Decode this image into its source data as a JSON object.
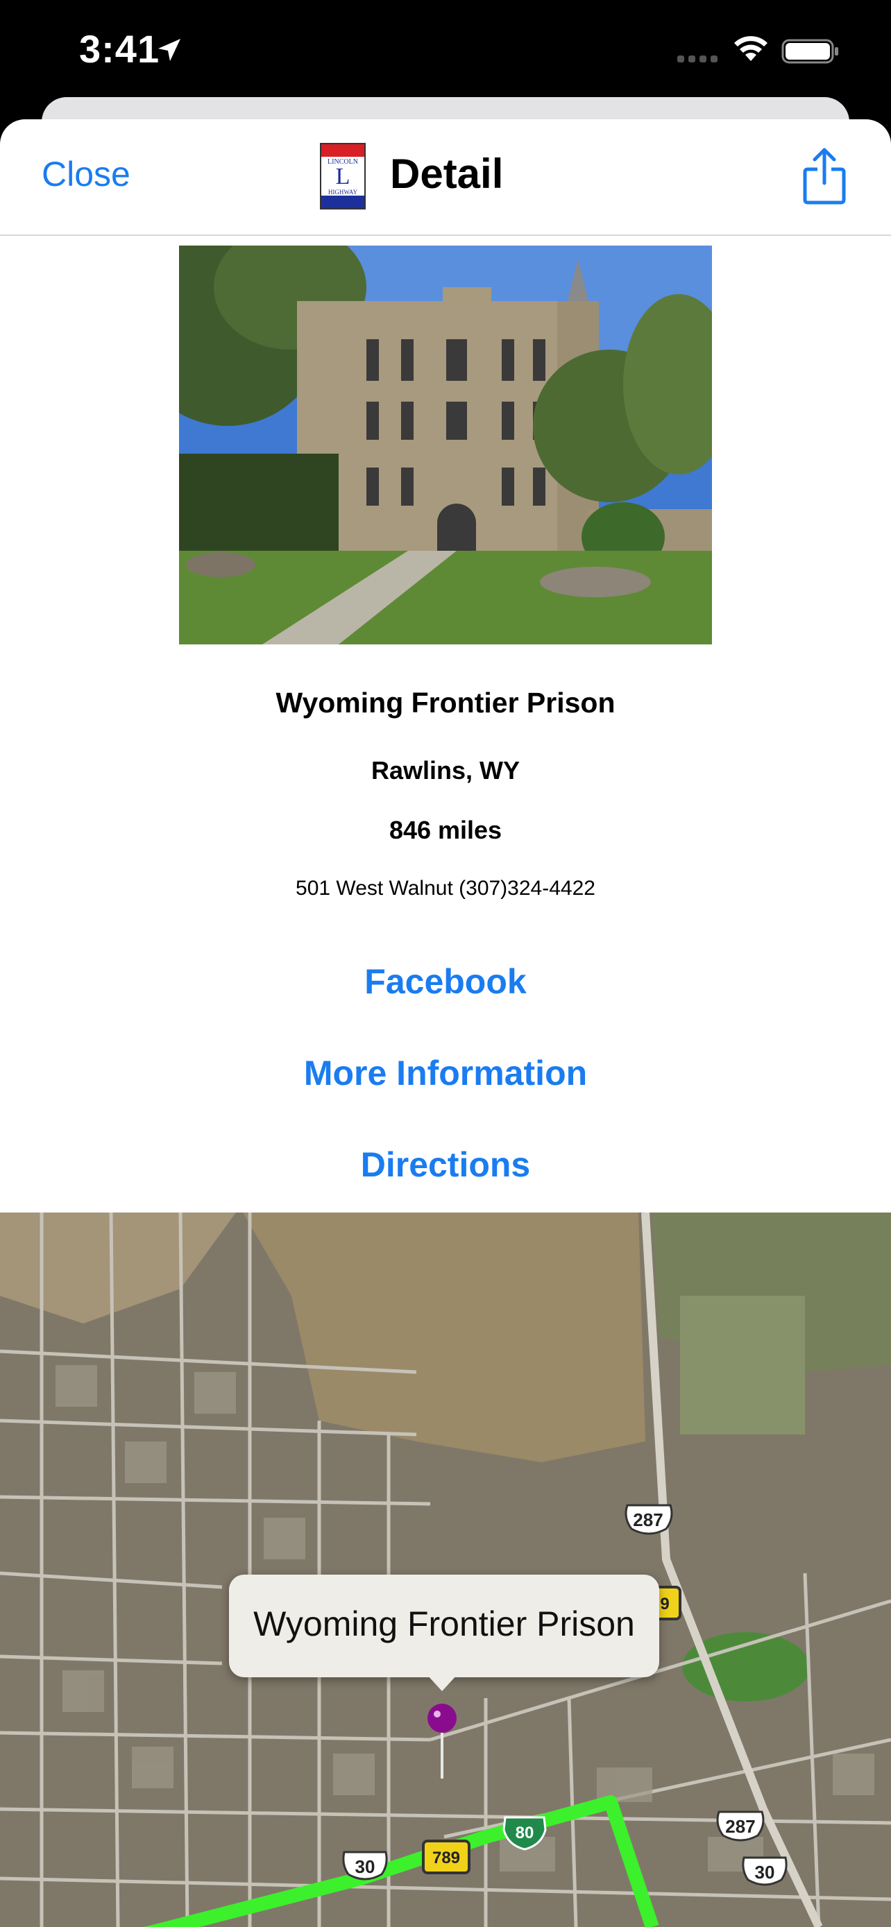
{
  "status_bar": {
    "time": "3:41"
  },
  "nav": {
    "close_label": "Close",
    "title": "Detail",
    "logo_text_top": "LINCOLN",
    "logo_letter": "L",
    "logo_text_bottom": "HIGHWAY"
  },
  "place": {
    "name": "Wyoming Frontier Prison",
    "city": "Rawlins, WY",
    "distance": "846 miles",
    "address_phone": "501 West Walnut (307)324-4422"
  },
  "links": {
    "facebook": "Facebook",
    "more_information": "More Information",
    "directions": "Directions"
  },
  "map": {
    "callout": "Wyoming Frontier Prison",
    "shields": {
      "us287_top": "287",
      "us287_bottom": "287",
      "us30_left": "30",
      "us30_right": "30",
      "i80": "80",
      "wy789": "789",
      "wy789_partial": "9"
    }
  },
  "colors": {
    "link_blue": "#1a7cf0",
    "route_green": "#3cf02c",
    "pin_purple": "#8a0c8e"
  }
}
